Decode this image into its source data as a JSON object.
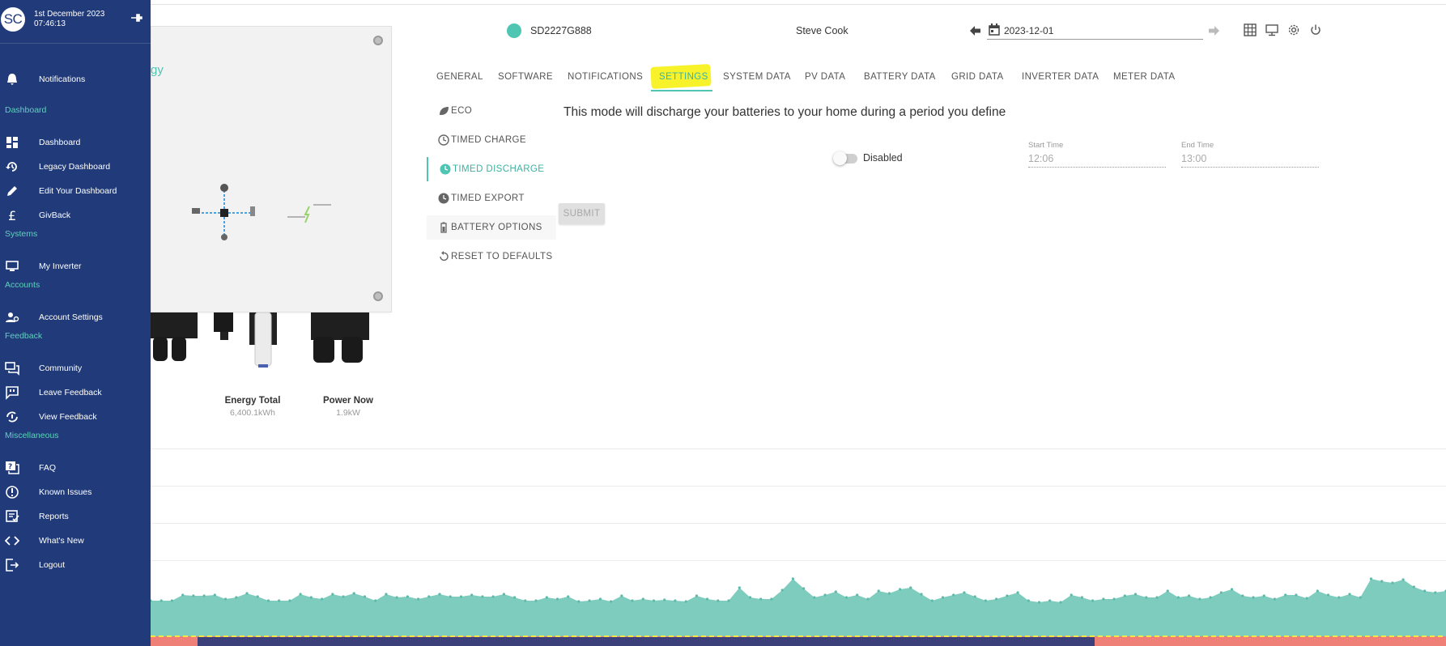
{
  "sidebar": {
    "avatar": "SC",
    "date": "1st December 2023",
    "time": "07:46:13",
    "items": [
      {
        "label": "Notifications",
        "icon": "bell-icon"
      },
      {
        "section": "Dashboard"
      },
      {
        "label": "Dashboard",
        "icon": "dashboard-icon"
      },
      {
        "label": "Legacy Dashboard",
        "icon": "history-icon"
      },
      {
        "label": "Edit Your Dashboard",
        "icon": "pencil-icon"
      },
      {
        "label": "GivBack",
        "icon": "pound-icon"
      },
      {
        "section": "Systems"
      },
      {
        "label": "My Inverter",
        "icon": "monitor-icon"
      },
      {
        "section": "Accounts"
      },
      {
        "label": "Account Settings",
        "icon": "account-settings-icon"
      },
      {
        "section": "Feedback"
      },
      {
        "label": "Community",
        "icon": "forum-icon"
      },
      {
        "label": "Leave Feedback",
        "icon": "message-icon"
      },
      {
        "label": "View Feedback",
        "icon": "feedback-view-icon"
      },
      {
        "section": "Miscellaneous"
      },
      {
        "label": "FAQ",
        "icon": "faq-icon"
      },
      {
        "label": "Known Issues",
        "icon": "alert-circle-icon"
      },
      {
        "label": "Reports",
        "icon": "reports-icon"
      },
      {
        "label": "What's New",
        "icon": "code-icon"
      },
      {
        "label": "Logout",
        "icon": "logout-icon"
      }
    ]
  },
  "header": {
    "serial": "SD2227G888",
    "user": "Steve Cook",
    "date": "2023-12-01"
  },
  "device": {
    "brand_fragment": "gy",
    "stats": [
      {
        "title": "Energy Total",
        "value": "6,400.1kWh"
      },
      {
        "title": "Power Now",
        "value": "1.9kW"
      }
    ]
  },
  "tabs": [
    "GENERAL",
    "SOFTWARE",
    "NOTIFICATIONS",
    "SETTINGS",
    "SYSTEM DATA",
    "PV DATA",
    "BATTERY DATA",
    "GRID DATA",
    "INVERTER DATA",
    "METER DATA"
  ],
  "active_tab": "SETTINGS",
  "settings_tabs": [
    "ECO",
    "TIMED CHARGE",
    "TIMED DISCHARGE",
    "TIMED EXPORT",
    "BATTERY OPTIONS",
    "RESET TO DEFAULTS"
  ],
  "active_settings_tab": "TIMED DISCHARGE",
  "panel": {
    "description": "This mode will discharge your batteries to your home during a period you define",
    "toggle_label": "Disabled",
    "toggle_on": false,
    "start_label": "Start Time",
    "start_value": "12:06",
    "end_label": "End Time",
    "end_value": "13:00",
    "submit_label": "SUBMIT"
  },
  "colors": {
    "sidebar_bg": "#213b7a",
    "accent": "#4ec6b3",
    "highlight": "#f8f22a",
    "chart_fill": "#7dccbe",
    "chart_red": "#ef8078",
    "chart_navy": "#3b3f7a"
  }
}
